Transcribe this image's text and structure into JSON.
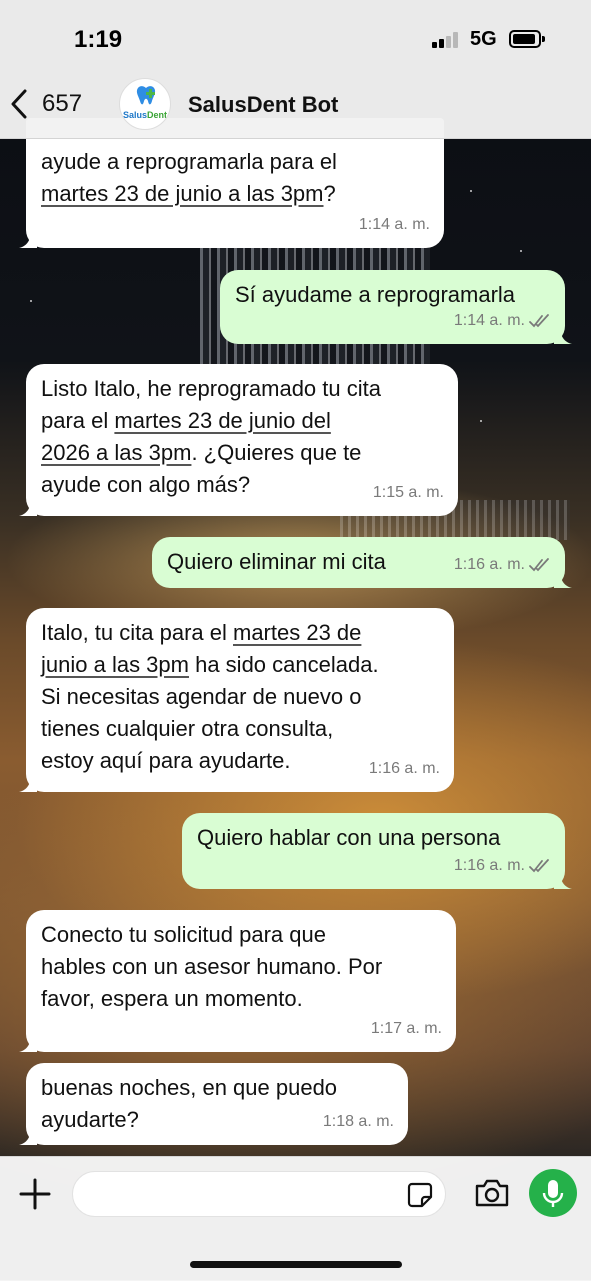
{
  "status_bar": {
    "time": "1:19",
    "network": "5G"
  },
  "header": {
    "back_count": "657",
    "contact_name": "SalusDent Bot",
    "avatar_logo_text_a": "Salus",
    "avatar_logo_text_b": "Dent"
  },
  "messages": [
    {
      "direction": "in",
      "segments": [
        {
          "t": "ayude a reprogramarla para el\n"
        },
        {
          "t": "martes 23 de junio a las 3pm",
          "u": true
        },
        {
          "t": "?"
        }
      ],
      "time": "1:14 a. m."
    },
    {
      "direction": "out",
      "segments": [
        {
          "t": "Sí ayudame a reprogramarla"
        }
      ],
      "time": "1:14 a. m.",
      "read": true
    },
    {
      "direction": "in",
      "segments": [
        {
          "t": "Listo Italo, he reprogramado tu cita\npara el "
        },
        {
          "t": "martes 23 de junio del\n2026 a las 3pm",
          "u": true
        },
        {
          "t": ". ¿Quieres que te\nayude con algo más?"
        }
      ],
      "time": "1:15 a. m."
    },
    {
      "direction": "out",
      "segments": [
        {
          "t": "Quiero eliminar mi cita"
        }
      ],
      "time": "1:16 a. m.",
      "read": true
    },
    {
      "direction": "in",
      "segments": [
        {
          "t": "Italo, tu cita para el "
        },
        {
          "t": "martes 23 de\njunio a las 3pm",
          "u": true
        },
        {
          "t": " ha sido cancelada.\nSi necesitas agendar de nuevo o\ntienes cualquier otra consulta,\nestoy aquí para ayudarte."
        }
      ],
      "time": "1:16 a. m."
    },
    {
      "direction": "out",
      "segments": [
        {
          "t": "Quiero hablar con una persona"
        }
      ],
      "time": "1:16 a. m.",
      "read": true
    },
    {
      "direction": "in",
      "segments": [
        {
          "t": "Conecto tu solicitud para que\nhables con un asesor humano. Por\nfavor, espera un momento."
        }
      ],
      "time": "1:17 a. m."
    },
    {
      "direction": "in",
      "segments": [
        {
          "t": "buenas noches, en que puedo\nayudarte?"
        }
      ],
      "time": "1:18 a. m."
    }
  ],
  "input": {
    "placeholder": ""
  },
  "colors": {
    "incoming_bubble": "#ffffff",
    "outgoing_bubble": "#d9fdd3",
    "mic_button": "#25b14a",
    "read_check": "#7a7a7a"
  },
  "icons": [
    "back-chevron-icon",
    "signal-icon",
    "battery-icon",
    "double-check-icon",
    "plus-icon",
    "sticker-icon",
    "camera-icon",
    "microphone-icon"
  ]
}
